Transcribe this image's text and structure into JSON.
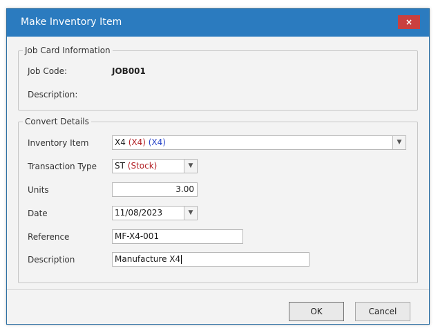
{
  "window": {
    "title": "Make Inventory Item",
    "close_glyph": "×"
  },
  "job_card": {
    "legend": "Job Card Information",
    "job_code_label": "Job Code:",
    "job_code_value": "JOB001",
    "description_label": "Description:"
  },
  "convert": {
    "legend": "Convert Details",
    "inventory_item": {
      "label": "Inventory Item",
      "value_code": "X4",
      "value_part_red": "(X4)",
      "value_part_blue": "(X4)"
    },
    "transaction_type": {
      "label": "Transaction Type",
      "value_code": "ST",
      "value_part_red": "(Stock)"
    },
    "units": {
      "label": "Units",
      "value": "3.00"
    },
    "date": {
      "label": "Date",
      "value": "11/08/2023"
    },
    "reference": {
      "label": "Reference",
      "value": "MF-X4-001"
    },
    "description": {
      "label": "Description",
      "value": "Manufacture X4"
    }
  },
  "buttons": {
    "ok": "OK",
    "cancel": "Cancel"
  },
  "icons": {
    "dropdown": "chevron-down-icon",
    "close": "close-icon"
  },
  "colors": {
    "titlebar": "#2b7bbf",
    "close_button": "#c9403f",
    "red_text": "#b21f24",
    "blue_text": "#2a46c9"
  }
}
